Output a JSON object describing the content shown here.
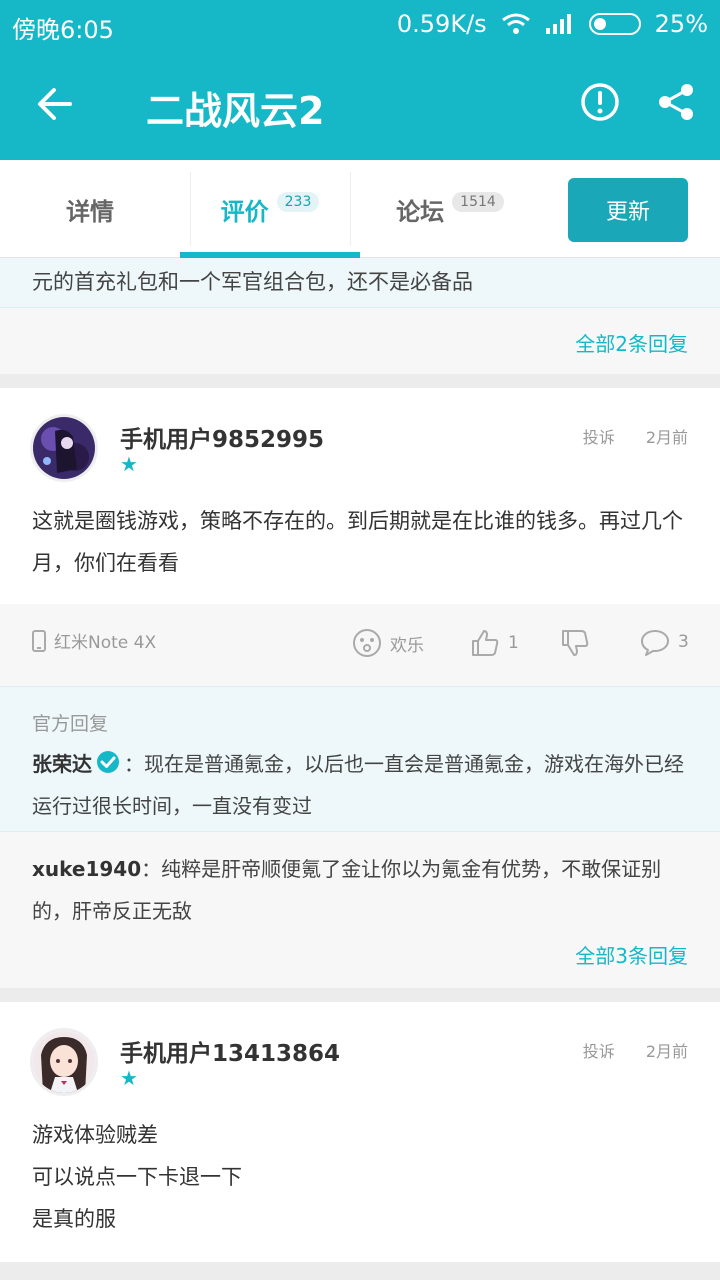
{
  "status_bar": {
    "time": "傍晚6:05",
    "net_speed": "0.59K/s",
    "battery": "25%"
  },
  "app_bar": {
    "title": "二战风云2"
  },
  "tabs": [
    {
      "label": "详情",
      "badge": ""
    },
    {
      "label": "评价",
      "badge": "233"
    },
    {
      "label": "论坛",
      "badge": "1514"
    }
  ],
  "update_button": "更新",
  "prev_official_reply": "元的首充礼包和一个军官组合包，还不是必备品",
  "prev_more_replies": "全部2条回复",
  "reviews": [
    {
      "username": "手机用户9852995",
      "stars": "★",
      "report": "投诉",
      "time": "2月前",
      "content": "这就是圈钱游戏，策略不存在的。到后期就是在比谁的钱多。再过几个月，你们在看看",
      "device": "红米Note 4X",
      "mood": "欢乐",
      "likes": "1",
      "comments": "3",
      "official_label": "官方回复",
      "official_name": "张荣达",
      "official_text": "：现在是普通氪金，以后也一直会是普通氪金，游戏在海外已经运行过很长时间，一直没有变过",
      "reply_name": "xuke1940",
      "reply_text": "：纯粹是肝帝顺便氪了金让你以为氪金有优势，不敢保证别的，肝帝反正无敌",
      "more_replies": "全部3条回复"
    },
    {
      "username": "手机用户13413864",
      "stars": "★",
      "report": "投诉",
      "time": "2月前",
      "content_lines": [
        "游戏体验贼差",
        "可以说点一下卡退一下",
        "是真的服"
      ]
    }
  ],
  "colors": {
    "primary": "#16b8c8",
    "official_bg": "#eef8fa"
  }
}
